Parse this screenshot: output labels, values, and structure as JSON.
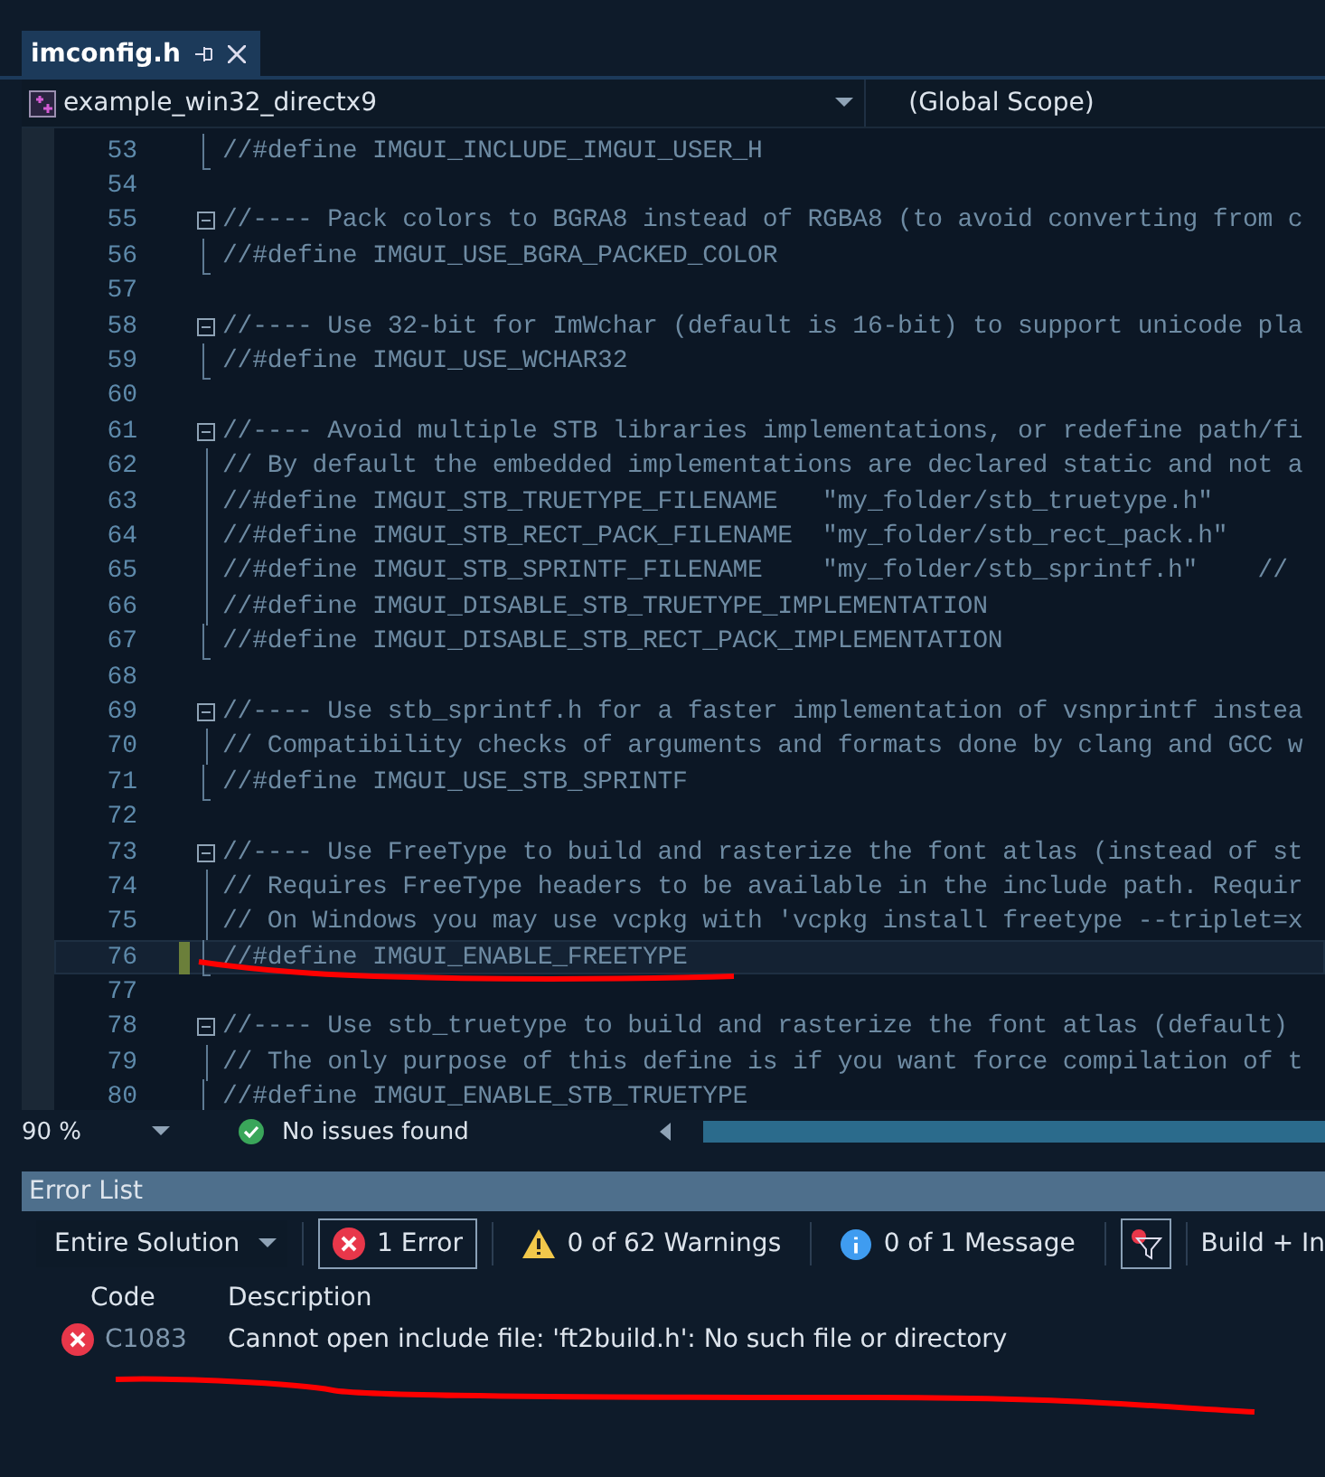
{
  "tabs": [
    {
      "label": "imconfig.h",
      "selected": true
    }
  ],
  "nav": {
    "project": "example_win32_directx9",
    "scope": "(Global Scope)"
  },
  "code_lines": [
    {
      "number": "53",
      "kind": "end",
      "text": "//#define IMGUI_INCLUDE_IMGUI_USER_H",
      "changed": false,
      "current": false
    },
    {
      "number": "54",
      "kind": "blank",
      "changed": false,
      "current": false
    },
    {
      "number": "55",
      "kind": "start",
      "text": "//---- Pack colors to BGRA8 instead of RGBA8 (to avoid converting from c",
      "changed": false,
      "current": false
    },
    {
      "number": "56",
      "kind": "end",
      "text": "//#define IMGUI_USE_BGRA_PACKED_COLOR",
      "changed": false,
      "current": false
    },
    {
      "number": "57",
      "kind": "blank",
      "changed": false,
      "current": false
    },
    {
      "number": "58",
      "kind": "start",
      "text": "//---- Use 32-bit for ImWchar (default is 16-bit) to support unicode pla",
      "changed": false,
      "current": false
    },
    {
      "number": "59",
      "kind": "end",
      "text": "//#define IMGUI_USE_WCHAR32",
      "changed": false,
      "current": false
    },
    {
      "number": "60",
      "kind": "blank",
      "changed": false,
      "current": false
    },
    {
      "number": "61",
      "kind": "start",
      "text": "//---- Avoid multiple STB libraries implementations, or redefine path/fi",
      "changed": false,
      "current": false
    },
    {
      "number": "62",
      "kind": "inner",
      "text": "// By default the embedded implementations are declared static and not a",
      "changed": false,
      "current": false
    },
    {
      "number": "63",
      "kind": "inner",
      "text": "//#define IMGUI_STB_TRUETYPE_FILENAME   \"my_folder/stb_truetype.h\"",
      "changed": false,
      "current": false
    },
    {
      "number": "64",
      "kind": "inner",
      "text": "//#define IMGUI_STB_RECT_PACK_FILENAME  \"my_folder/stb_rect_pack.h\"",
      "changed": false,
      "current": false
    },
    {
      "number": "65",
      "kind": "inner",
      "text": "//#define IMGUI_STB_SPRINTF_FILENAME    \"my_folder/stb_sprintf.h\"    //",
      "changed": false,
      "current": false
    },
    {
      "number": "66",
      "kind": "inner",
      "text": "//#define IMGUI_DISABLE_STB_TRUETYPE_IMPLEMENTATION",
      "changed": false,
      "current": false
    },
    {
      "number": "67",
      "kind": "end",
      "text": "//#define IMGUI_DISABLE_STB_RECT_PACK_IMPLEMENTATION",
      "changed": false,
      "current": false
    },
    {
      "number": "68",
      "kind": "blank",
      "changed": false,
      "current": false
    },
    {
      "number": "69",
      "kind": "start",
      "text": "//---- Use stb_sprintf.h for a faster implementation of vsnprintf instea",
      "changed": false,
      "current": false
    },
    {
      "number": "70",
      "kind": "inner",
      "text": "// Compatibility checks of arguments and formats done by clang and GCC w",
      "changed": false,
      "current": false
    },
    {
      "number": "71",
      "kind": "end",
      "text": "//#define IMGUI_USE_STB_SPRINTF",
      "changed": false,
      "current": false
    },
    {
      "number": "72",
      "kind": "blank",
      "changed": false,
      "current": false
    },
    {
      "number": "73",
      "kind": "start",
      "text": "//---- Use FreeType to build and rasterize the font atlas (instead of st",
      "changed": false,
      "current": false
    },
    {
      "number": "74",
      "kind": "inner",
      "text": "// Requires FreeType headers to be available in the include path. Requir",
      "changed": false,
      "current": false
    },
    {
      "number": "75",
      "kind": "inner",
      "text": "// On Windows you may use vcpkg with 'vcpkg install freetype --triplet=x",
      "changed": false,
      "current": false
    },
    {
      "number": "76",
      "kind": "end",
      "text": "//#define IMGUI_ENABLE_FREETYPE",
      "changed": true,
      "current": true
    },
    {
      "number": "77",
      "kind": "blank",
      "changed": false,
      "current": false
    },
    {
      "number": "78",
      "kind": "start",
      "text": "//---- Use stb_truetype to build and rasterize the font atlas (default)",
      "changed": false,
      "current": false
    },
    {
      "number": "79",
      "kind": "inner",
      "text": "// The only purpose of this define is if you want force compilation of t",
      "changed": false,
      "current": false
    },
    {
      "number": "80",
      "kind": "end",
      "text": "//#define IMGUI_ENABLE_STB_TRUETYPE",
      "changed": false,
      "current": false
    }
  ],
  "editor_status": {
    "zoom": "90 %",
    "issues": "No issues found"
  },
  "error_list": {
    "title": "Error List",
    "scope": "Entire Solution",
    "filters": [
      {
        "kind": "error",
        "label": "1 Error",
        "selected": true
      },
      {
        "kind": "warning",
        "label": "0 of 62 Warnings",
        "selected": false
      },
      {
        "kind": "info",
        "label": "0 of 1 Message",
        "selected": false
      }
    ],
    "build_filter": "Build + In",
    "columns": [
      "Code",
      "Description"
    ],
    "rows": [
      {
        "code": "C1083",
        "description": "Cannot open include file: 'ft2build.h': No such file or directory"
      }
    ]
  }
}
